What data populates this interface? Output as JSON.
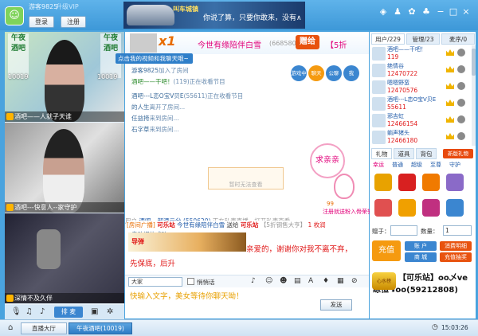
{
  "titlebar": {
    "guest_name": "游客9825",
    "upgrade_link": "升级VIP",
    "login_label": "登录",
    "register_label": "注册",
    "banner_logo": "叫车城镇",
    "banner_text": "你说了算，只要你敢来，没有∧",
    "icons": [
      "wifi-icon",
      "person-icon",
      "gear-icon",
      "shirt-icon",
      "minimize-icon",
      "maximize-icon",
      "close-icon"
    ],
    "icon_glyphs": [
      "◈",
      "♟",
      "✿",
      "♣",
      "−",
      "□",
      "×"
    ]
  },
  "videos": [
    {
      "label": "酒吧——人就子天谁",
      "side_logo": "午夜酒吧",
      "number": "10019"
    },
    {
      "label": "酒吧---快意人--家守护",
      "side_logo": "",
      "number": ""
    },
    {
      "label": "深情不及久伴",
      "side_logo": "",
      "number": ""
    }
  ],
  "video_toolbar": {
    "queue_label": "排 麦"
  },
  "chat": {
    "gift_x1": "x1",
    "title": "今世有缘陪伴白雪",
    "title_id": "(668580)",
    "gift_tag": "赠给",
    "discount": "【5折",
    "tooltip": "点击我的视频和我聊天哦~",
    "lines": [
      {
        "name": "游客9825",
        "text": "加入了房间"
      },
      {
        "name": "酒吧——干吧！",
        "text": "(119)正在收看节目"
      },
      {
        "name": "酒吧---L恋O宝V贝E",
        "text": "(55611)正在收看节目"
      },
      {
        "name": "的人生",
        "text": "离开了房间..."
      },
      {
        "name": "任益挎",
        "text": "来到房间..."
      },
      {
        "name": "石字草",
        "text": "来到房间..."
      }
    ],
    "round_buttons": [
      "游戏中心",
      "聊天",
      "公聊",
      "我"
    ],
    "no_support": "暂时无法查看",
    "plea": "求亲亲",
    "fan_score": "99",
    "fan_label": "注册就送粉入骨荣誉",
    "broadcast_user": "用户",
    "broadcast_name": "酒吧---部酒云兮",
    "broadcast_id": "(550620)",
    "broadcast_text": "正在私麦直播，打开私麦查看",
    "broadcast_line2": "启动媒体成功",
    "room_notice": "[房间广播]",
    "room_notice_text": "可乐站",
    "room_notice_text2": "今世有缘陪伴白雪",
    "room_notice_send": "送给",
    "room_notice_target": "可乐站",
    "room_notice_tail": "【5折钢售大亨】",
    "room_notice_count": "1 枚润",
    "missile_label": "导弹",
    "love_text": "亲爱的，谢谢你对我不离不弃，",
    "sticky_text": "先保底，后升",
    "audience_select": "大家",
    "whisper_label": "悄悄话",
    "input_placeholder": "快输入文字，美女等待你聊天呦！",
    "send_label": "发送"
  },
  "right": {
    "tabs": [
      "用户/229",
      "管理/23",
      "麦序/0"
    ],
    "users": [
      {
        "name": "酒吧——干吧！",
        "id": "119"
      },
      {
        "name": "绝情谷",
        "id": "12470722"
      },
      {
        "name": "嗯嗯野蛮",
        "id": "12470576"
      },
      {
        "name": "酒吧---L恋O宝V贝E",
        "id": "55611"
      },
      {
        "name": "邪吉虹",
        "id": "12466154"
      },
      {
        "name": "躺声猪头",
        "id": "12466180"
      }
    ],
    "gift_tabs": [
      "礼物",
      "道具",
      "背包"
    ],
    "gift_rules": "新版礼物",
    "gift_subtabs": [
      "幸运",
      "普通",
      "超级",
      "至尊",
      "守护"
    ],
    "gift_colors": [
      "#e8a200",
      "#d82020",
      "#f07a00",
      "#8a6ac8",
      "#e05050",
      "#f0a000",
      "#c03080",
      "#3b86d0"
    ],
    "qty_label": "赠于：",
    "count_label": "数量：",
    "count_value": "1",
    "recharge_label": "充值",
    "btn_account": "账 户",
    "btn_consume": "消费明细",
    "btn_mall": "商 城",
    "btn_ranking": "充值抽奖",
    "promo_badge": "心水榜",
    "promo_text": "【可乐站】oo乄ve练恒↘oo(59212808)"
  },
  "statusbar": {
    "hall_label": "直播大厅",
    "room_label": "午夜酒吧(10019)",
    "clock": "15:03:26"
  }
}
